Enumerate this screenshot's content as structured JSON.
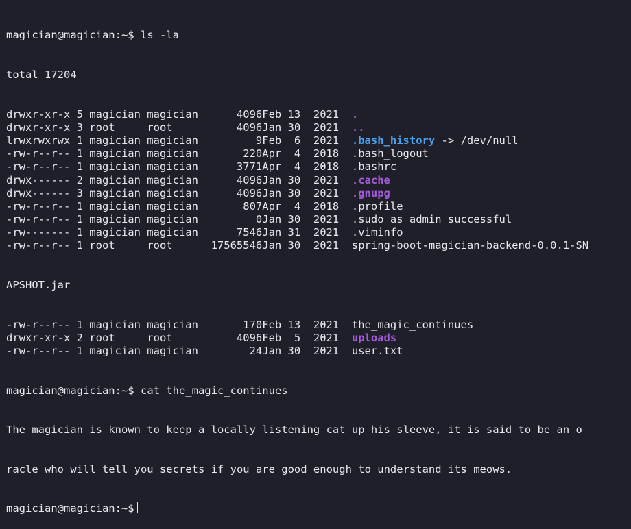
{
  "terminal": {
    "prompt": "magician@magician:~$",
    "cmd_ls": "ls -la",
    "total": "total 17204",
    "listing": [
      {
        "perm": "drwxr-xr-x",
        "links": "5",
        "owner": "magician",
        "group": "magician",
        "size": "4096",
        "date": "Feb 13  2021",
        "name": ".",
        "kind": "dir",
        "target": ""
      },
      {
        "perm": "drwxr-xr-x",
        "links": "3",
        "owner": "root",
        "group": "root",
        "size": "4096",
        "date": "Jan 30  2021",
        "name": "..",
        "kind": "dir",
        "target": ""
      },
      {
        "perm": "lrwxrwxrwx",
        "links": "1",
        "owner": "magician",
        "group": "magician",
        "size": "9",
        "date": "Feb  6  2021",
        "name": ".bash_history",
        "kind": "link",
        "target": " -> /dev/null"
      },
      {
        "perm": "-rw-r--r--",
        "links": "1",
        "owner": "magician",
        "group": "magician",
        "size": "220",
        "date": "Apr  4  2018",
        "name": ".bash_logout",
        "kind": "file",
        "target": ""
      },
      {
        "perm": "-rw-r--r--",
        "links": "1",
        "owner": "magician",
        "group": "magician",
        "size": "3771",
        "date": "Apr  4  2018",
        "name": ".bashrc",
        "kind": "file",
        "target": ""
      },
      {
        "perm": "drwx------",
        "links": "2",
        "owner": "magician",
        "group": "magician",
        "size": "4096",
        "date": "Jan 30  2021",
        "name": ".cache",
        "kind": "dir",
        "target": ""
      },
      {
        "perm": "drwx------",
        "links": "3",
        "owner": "magician",
        "group": "magician",
        "size": "4096",
        "date": "Jan 30  2021",
        "name": ".gnupg",
        "kind": "dir",
        "target": ""
      },
      {
        "perm": "-rw-r--r--",
        "links": "1",
        "owner": "magician",
        "group": "magician",
        "size": "807",
        "date": "Apr  4  2018",
        "name": ".profile",
        "kind": "file",
        "target": ""
      },
      {
        "perm": "-rw-r--r--",
        "links": "1",
        "owner": "magician",
        "group": "magician",
        "size": "0",
        "date": "Jan 30  2021",
        "name": ".sudo_as_admin_successful",
        "kind": "file",
        "target": ""
      },
      {
        "perm": "-rw-------",
        "links": "1",
        "owner": "magician",
        "group": "magician",
        "size": "7546",
        "date": "Jan 31  2021",
        "name": ".viminfo",
        "kind": "file",
        "target": ""
      },
      {
        "perm": "-rw-r--r--",
        "links": "1",
        "owner": "root",
        "group": "root",
        "size": "17565546",
        "date": "Jan 30  2021",
        "name": "spring-boot-magician-backend-0.0.1-SN",
        "kind": "file",
        "target": ""
      }
    ],
    "wrap_line": "APSHOT.jar",
    "listing2": [
      {
        "perm": "-rw-r--r--",
        "links": "1",
        "owner": "magician",
        "group": "magician",
        "size": "170",
        "date": "Feb 13  2021",
        "name": "the_magic_continues",
        "kind": "file",
        "target": ""
      },
      {
        "perm": "drwxr-xr-x",
        "links": "2",
        "owner": "root",
        "group": "root",
        "size": "4096",
        "date": "Feb  5  2021",
        "name": "uploads",
        "kind": "dir",
        "target": ""
      },
      {
        "perm": "-rw-r--r--",
        "links": "1",
        "owner": "magician",
        "group": "magician",
        "size": "24",
        "date": "Jan 30  2021",
        "name": "user.txt",
        "kind": "file",
        "target": ""
      }
    ],
    "cmd_cat": "cat the_magic_continues",
    "output_1": "The magician is known to keep a locally listening cat up his sleeve, it is said to be an o",
    "output_2": "racle who will tell you secrets if you are good enough to understand its meows."
  },
  "colors": {
    "background": "#1e1f28",
    "text": "#e7e8ee",
    "directory": "#a45cdc",
    "symlink": "#4aa2f0"
  }
}
